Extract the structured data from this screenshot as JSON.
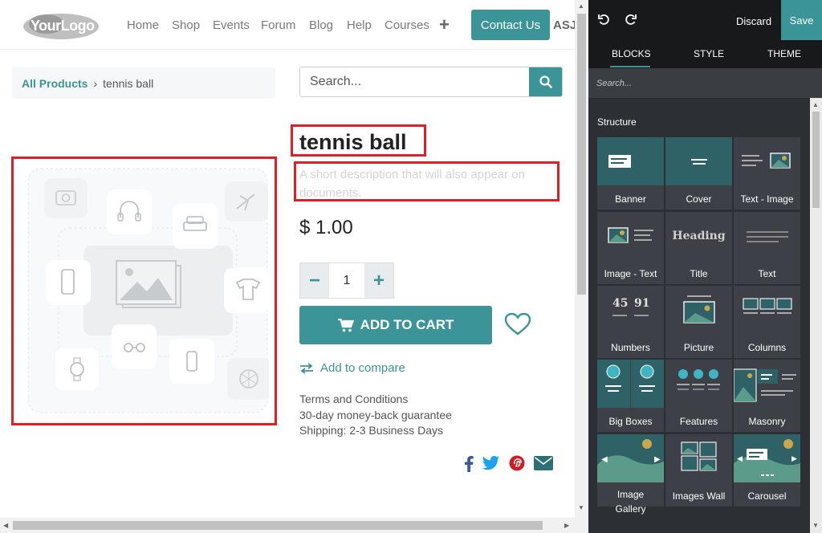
{
  "navbar": {
    "logo_text": "YourLogo",
    "links": [
      "Home",
      "Shop",
      "Events",
      "Forum",
      "Blog",
      "Help",
      "Courses"
    ],
    "plus": "+",
    "contact_label": "Contact Us",
    "user_initials": "ASJ"
  },
  "breadcrumb": {
    "parent": "All Products",
    "separator": "›",
    "current": "tennis ball"
  },
  "search": {
    "placeholder": "Search...",
    "icon": "search-icon"
  },
  "product": {
    "title": "tennis ball",
    "description": "A short description that will also appear on documents.",
    "price": "$ 1.00",
    "quantity": "1",
    "qty_minus": "−",
    "qty_plus": "+",
    "add_to_cart_label": "ADD TO CART",
    "compare_label": "Add to compare",
    "terms": [
      "Terms and Conditions",
      "30-day money-back guarantee",
      "Shipping: 2-3 Business Days"
    ]
  },
  "social_icons": [
    "facebook-icon",
    "twitter-icon",
    "pinterest-icon",
    "email-icon"
  ],
  "editor": {
    "discard_label": "Discard",
    "save_label": "Save",
    "tabs": [
      "BLOCKS",
      "STYLE",
      "THEME"
    ],
    "active_tab": "BLOCKS",
    "search_placeholder": "Search...",
    "section_label": "Structure",
    "blocks": [
      "Banner",
      "Cover",
      "Text - Image",
      "Image - Text",
      "Title",
      "Text",
      "Numbers",
      "Picture",
      "Columns",
      "Big Boxes",
      "Features",
      "Masonry",
      "Image Gallery",
      "Images Wall",
      "Carousel"
    ],
    "title_thumb_text": "Heading",
    "numbers_thumb": [
      "45",
      "91"
    ]
  },
  "colors": {
    "accent": "#3b9497",
    "highlight_frame": "#e02026",
    "editor_bg": "#2c2f33",
    "thumb_teal": "#2e6266"
  }
}
